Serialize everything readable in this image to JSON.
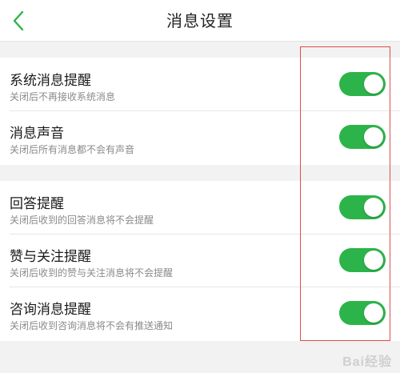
{
  "header": {
    "title": "消息设置",
    "back_icon": "chevron-left-icon"
  },
  "colors": {
    "accent": "#2cb44a",
    "toggle_on": "#2cb44a",
    "annotation_border": "#e24b4b"
  },
  "groups": [
    {
      "items": [
        {
          "title": "系统消息提醒",
          "subtitle": "关闭后不再接收系统消息",
          "enabled": true
        },
        {
          "title": "消息声音",
          "subtitle": "关闭后所有消息都不会有声音",
          "enabled": true
        }
      ]
    },
    {
      "items": [
        {
          "title": "回答提醒",
          "subtitle": "关闭后收到的回答消息将不会提醒",
          "enabled": true
        },
        {
          "title": "赞与关注提醒",
          "subtitle": "关闭后收到的赞与关注消息将不会提醒",
          "enabled": true
        },
        {
          "title": "咨询消息提醒",
          "subtitle": "关闭后收到咨询消息将不会有推送通知",
          "enabled": true
        }
      ]
    }
  ],
  "watermark": "Bai经验"
}
